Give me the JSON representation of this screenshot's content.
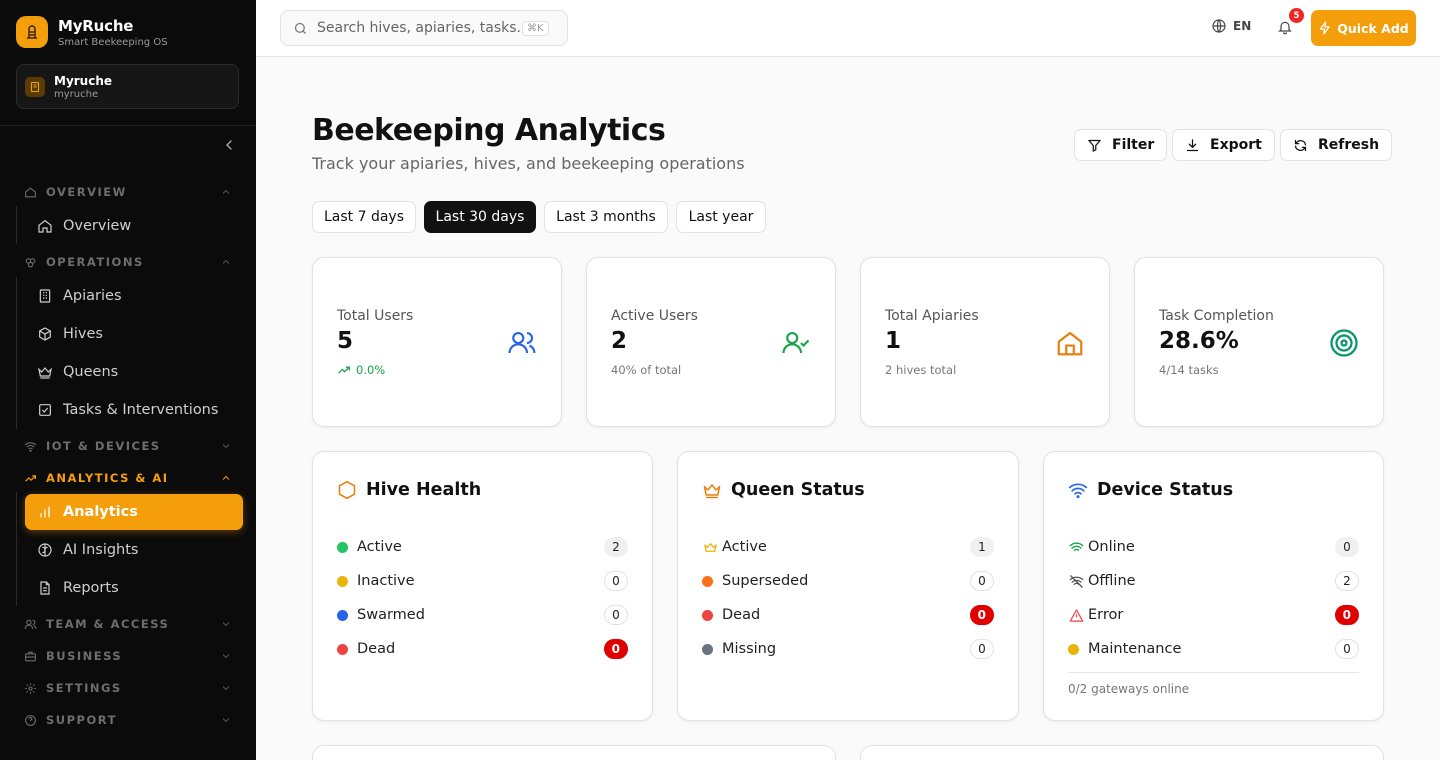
{
  "sidebar": {
    "brand_name": "MyRuche",
    "brand_subtitle": "Smart Beekeeping OS",
    "org_name": "Myruche",
    "org_slug": "myruche",
    "sections": {
      "overview": "OVERVIEW",
      "operations": "OPERATIONS",
      "iot": "IOT & DEVICES",
      "analytics": "ANALYTICS & AI",
      "team": "TEAM & ACCESS",
      "business": "BUSINESS",
      "settings": "SETTINGS",
      "support": "SUPPORT"
    },
    "items": {
      "overview": "Overview",
      "apiaries": "Apiaries",
      "hives": "Hives",
      "queens": "Queens",
      "tasks": "Tasks & Interventions",
      "analytics": "Analytics",
      "ai_insights": "AI Insights",
      "reports": "Reports"
    },
    "active_item": "Analytics"
  },
  "topbar": {
    "search_placeholder": "Search hives, apiaries, tasks...",
    "search_shortcut": "⌘K",
    "language": "EN",
    "notification_count": "5",
    "quick_add_label": "Quick Add"
  },
  "header": {
    "title": "Beekeeping Analytics",
    "subtitle": "Track your apiaries, hives, and beekeeping operations",
    "filter_label": "Filter",
    "export_label": "Export",
    "refresh_label": "Refresh"
  },
  "ranges": {
    "r7": "Last 7 days",
    "r30": "Last 30 days",
    "r3m": "Last 3 months",
    "r1y": "Last year",
    "selected": "Last 30 days"
  },
  "stats": {
    "total_users": {
      "label": "Total Users",
      "value": "5",
      "note": "0.0%"
    },
    "active_users": {
      "label": "Active Users",
      "value": "2",
      "note": "40% of total"
    },
    "total_apiaries": {
      "label": "Total Apiaries",
      "value": "1",
      "note": "2 hives total"
    },
    "task_completion": {
      "label": "Task Completion",
      "value": "28.6%",
      "note": "4/14 tasks"
    }
  },
  "hive_health": {
    "title": "Hive Health",
    "rows": [
      {
        "label": "Active",
        "count": "2",
        "color": "#22c55e"
      },
      {
        "label": "Inactive",
        "count": "0",
        "color": "#eab308"
      },
      {
        "label": "Swarmed",
        "count": "0",
        "color": "#2563eb"
      },
      {
        "label": "Dead",
        "count": "0",
        "color": "#ef4444"
      }
    ]
  },
  "queen_status": {
    "title": "Queen Status",
    "rows": [
      {
        "label": "Active",
        "count": "1",
        "icon": "crown-icon"
      },
      {
        "label": "Superseded",
        "count": "0",
        "color": "#f97316"
      },
      {
        "label": "Dead",
        "count": "0",
        "color": "#ef4444"
      },
      {
        "label": "Missing",
        "count": "0",
        "color": "#6b7280"
      }
    ]
  },
  "device_status": {
    "title": "Device Status",
    "rows": [
      {
        "label": "Online",
        "count": "0",
        "icon": "wifi-icon"
      },
      {
        "label": "Offline",
        "count": "2",
        "icon": "wifi-off-icon"
      },
      {
        "label": "Error",
        "count": "0",
        "icon": "alert-triangle-icon"
      },
      {
        "label": "Maintenance",
        "count": "0",
        "color": "#eab308"
      }
    ],
    "footer": "0/2 gateways online"
  },
  "colors": {
    "accent": "#f59e0b",
    "success": "#16a34a",
    "danger": "#e00000",
    "info": "#2563eb"
  }
}
